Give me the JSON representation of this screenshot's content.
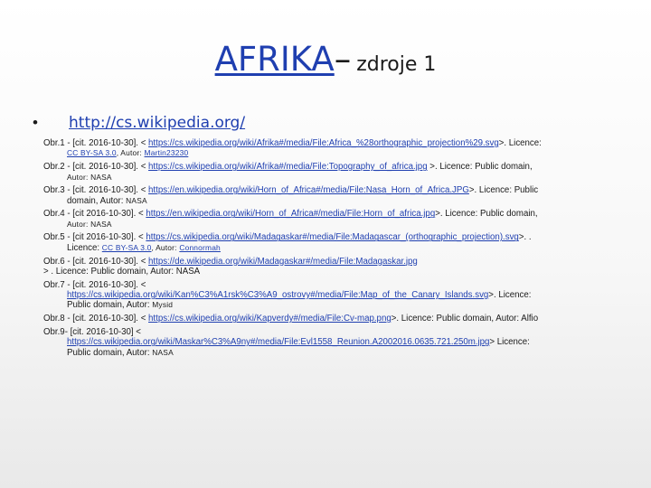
{
  "title": {
    "main": "AFRIKA",
    "dash": "–",
    "sub": "zdroje 1"
  },
  "bullet": {
    "symbol": "•",
    "link": "http://cs.wikipedia.org/"
  },
  "refs": [
    {
      "prefix": "Obr.1 - [cit. 2016-10-30]. < ",
      "url": "https://cs.wikipedia.org/wiki/Afrika#/media/File:Africa_%28orthographic_projection%29.svg",
      "middle": ">. Licence:",
      "license_link": "CC BY-SA 3.0",
      "author_label": ", Autor:",
      "author_link": "Martin23230"
    },
    {
      "prefix": "Obr.2 - [cit. 2016-10-30]. < ",
      "url": "https://cs.wikipedia.org/wiki/Afrika#/media/File:Topography_of_africa.jpg",
      "suffix": " >. Licence: Public domain,",
      "author": "Autor: NASA"
    },
    {
      "prefix": "Obr.3 - [cit. 2016-10-30]. < ",
      "url": "https://en.wikipedia.org/wiki/Horn_of_Africa#/media/File:Nasa_Horn_of_Africa.JPG",
      "suffix": ">. Licence: Public",
      "cont_text": "domain, Autor:",
      "author": "NASA"
    },
    {
      "prefix": "Obr.4 - [cit 2016-10-30]. < ",
      "url": "https://en.wikipedia.org/wiki/Horn_of_Africa#/media/File:Horn_of_africa.jpg",
      "suffix": ">. Licence: Public domain,",
      "author": "Autor: NASA"
    },
    {
      "prefix": "Obr.5 - [cit 2016-10-30]. < ",
      "url": "https://cs.wikipedia.org/wiki/Madagaskar#/media/File:Madagascar_(orthographic_projection).svg",
      "suffix": ">. .",
      "license_label": "Licence:",
      "license_link": "CC BY-SA 3.0",
      "author_label": ", Autor:",
      "author_link": "Connormah"
    },
    {
      "prefix": "Obr.6 - [cit. 2016-10-30]. < ",
      "url": "https://de.wikipedia.org/wiki/Madagaskar#/media/File:Madagaskar.jpg",
      "line2": "> . Licence: Public domain, Autor: NASA"
    },
    {
      "prefix": "Obr.7 - [cit. 2016-10-30]. <",
      "url": "https://cs.wikipedia.org/wiki/Kan%C3%A1rsk%C3%A9_ostrovy#/media/File:Map_of_the_Canary_Islands.svg",
      "suffix": ">. Licence:",
      "cont_text": "Public domain, Autor:",
      "author": "Mysid"
    },
    {
      "prefix": "Obr.8 - [cit. 2016-10-30]. < ",
      "url": "https://cs.wikipedia.org/wiki/Kapverdy#/media/File:Cv-map.png",
      "suffix": ">. Licence: Public domain,  Autor: Alfio"
    },
    {
      "prefix": "Obr.9- [cit. 2016-10-30] <",
      "url": "https://cs.wikipedia.org/wiki/Maskar%C3%A9ny#/media/File:Evl1558_Reunion.A2002016.0635.721.250m.jpg",
      "suffix": "> Licence:",
      "cont_text": "Public domain, Autor:",
      "author": "NASA"
    }
  ]
}
